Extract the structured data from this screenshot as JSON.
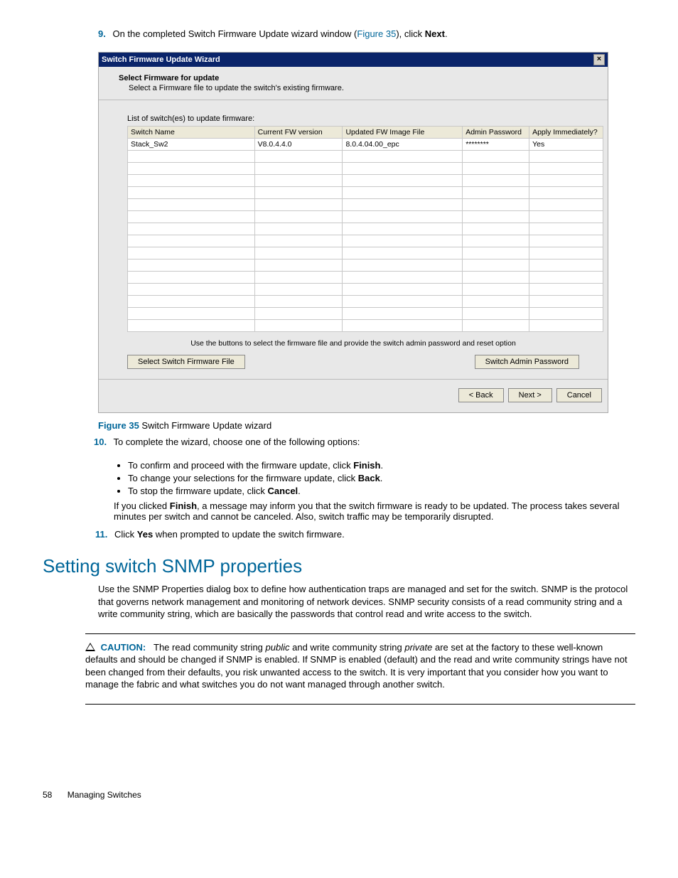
{
  "step9": {
    "num": "9.",
    "pre": "On the completed Switch Firmware Update wizard window (",
    "link": "Figure 35",
    "mid": "), click ",
    "bold": "Next",
    "post": "."
  },
  "dialog": {
    "title": "Switch Firmware Update Wizard",
    "header_title": "Select Firmware for update",
    "header_sub": "Select a Firmware file to update the switch's existing firmware.",
    "list_label": "List of switch(es) to update firmware:",
    "cols": {
      "c1": "Switch Name",
      "c2": "Current FW version",
      "c3": "Updated FW Image File",
      "c4": "Admin Password",
      "c5": "Apply Immediately?"
    },
    "row": {
      "c1": "Stack_Sw2",
      "c2": "V8.0.4.4.0",
      "c3": "8.0.4.04.00_epc",
      "c4": "********",
      "c5": "Yes"
    },
    "hint": "Use the buttons to select the firmware file and provide the switch admin password and reset option",
    "btn_select": "Select Switch Firmware File",
    "btn_pwd": "Switch Admin Password",
    "btn_back": "< Back",
    "btn_next": "Next >",
    "btn_cancel": "Cancel"
  },
  "figcap": {
    "num": "Figure 35",
    "text": " Switch Firmware Update wizard"
  },
  "step10": {
    "num": "10.",
    "text": "To complete the wizard, choose one of the following options:",
    "b1a": "To confirm and proceed with the firmware update, click ",
    "b1b": "Finish",
    "b1c": ".",
    "b2a": "To change your selections for the firmware update, click ",
    "b2b": "Back",
    "b2c": ".",
    "b3a": "To stop the firmware update, click ",
    "b3b": "Cancel",
    "b3c": ".",
    "p1a": "If you clicked ",
    "p1b": "Finish",
    "p1c": ", a message may inform you that the switch firmware is ready to be updated. The process takes several minutes per switch and cannot be canceled. Also, switch traffic may be temporarily disrupted."
  },
  "step11": {
    "num": "11.",
    "a": "Click ",
    "b": "Yes",
    "c": " when prompted to update the switch firmware."
  },
  "section_title": "Setting switch SNMP properties",
  "section_body": "Use the SNMP Properties dialog box to define how authentication traps are managed and set for the switch. SNMP is the protocol that governs network management and monitoring of network devices. SNMP security consists of a read community string and a write community string, which are basically the passwords that control read and write access to the switch.",
  "caution": {
    "label": "CAUTION:",
    "t1": "The read community string ",
    "i1": "public",
    "t2": " and write community string ",
    "i2": "private",
    "t3": " are set at the factory to these well-known defaults and should be changed if SNMP is enabled. If SNMP is enabled (default) and the read and write community strings have not been changed from their defaults, you risk unwanted access to the switch. It is very important that you consider how you want to manage the fabric and what switches you do not want managed through another switch."
  },
  "footer": {
    "page": "58",
    "title": "Managing Switches"
  }
}
